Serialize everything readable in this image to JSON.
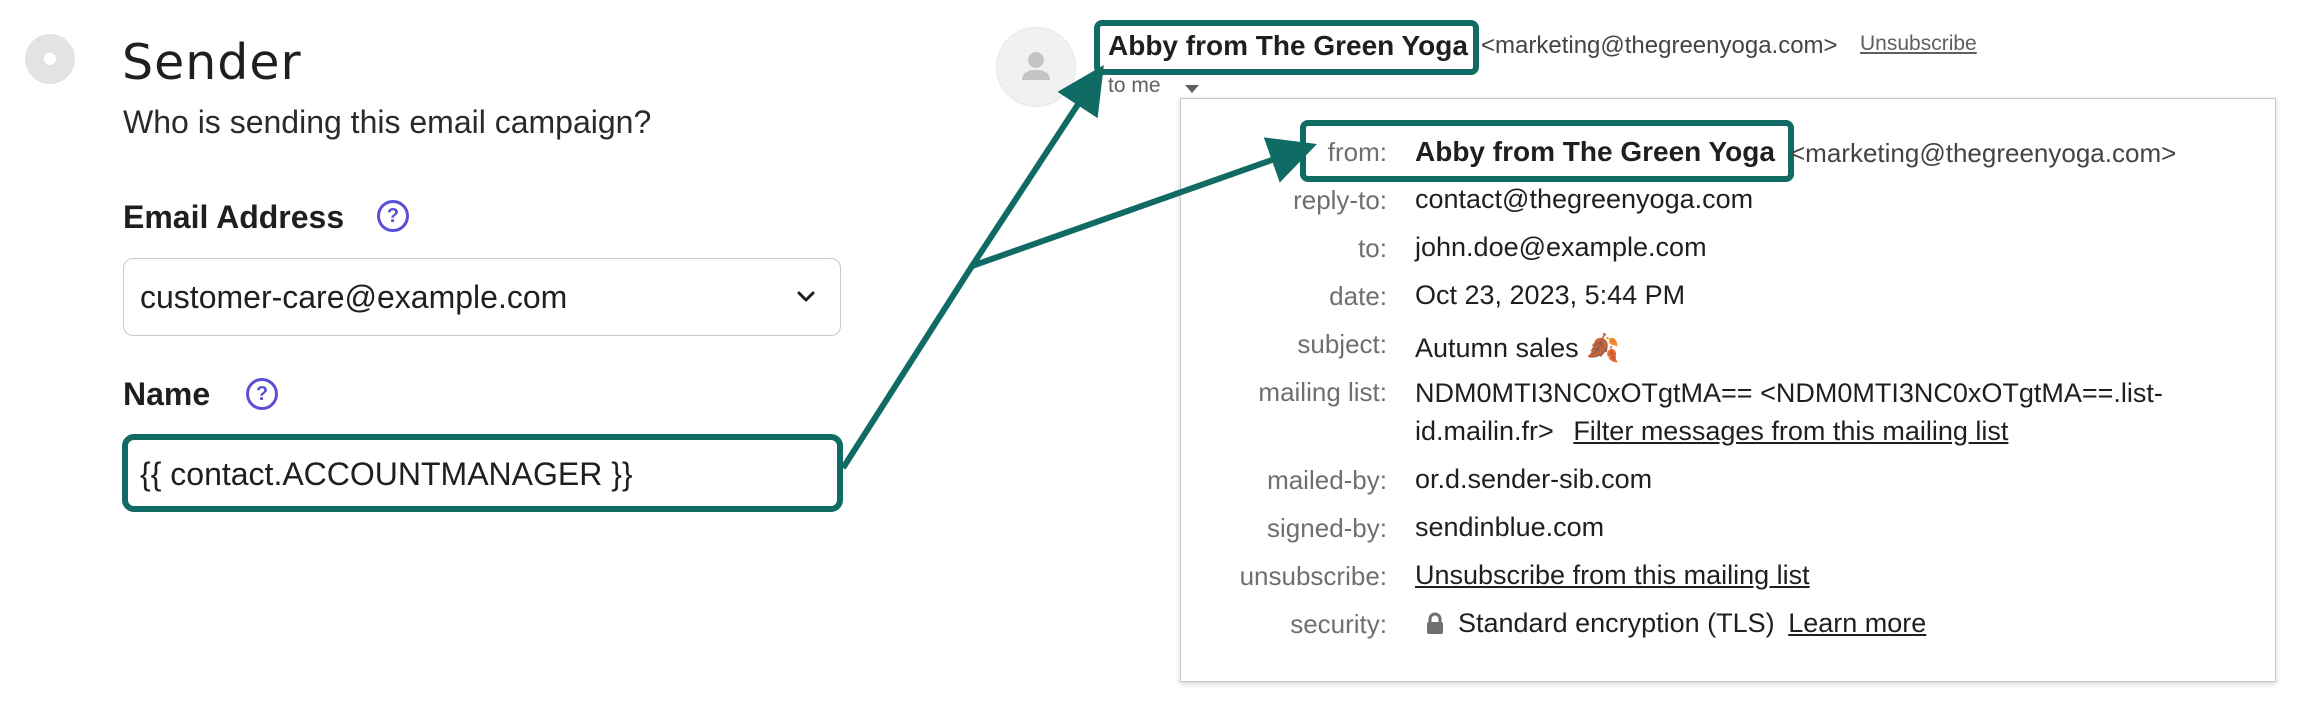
{
  "left_panel": {
    "title": "Sender",
    "subtitle": "Who is sending this email campaign?",
    "email_label": "Email Address",
    "email_value": "customer-care@example.com",
    "name_label": "Name",
    "name_value": "{{ contact.ACCOUNTMANAGER }}",
    "help_glyph": "?"
  },
  "email_header": {
    "sender_name": "Abby from The Green Yoga",
    "sender_email": "<marketing@thegreenyoga.com>",
    "unsubscribe": "Unsubscribe",
    "to_me": "to me"
  },
  "details": {
    "from_label": "from:",
    "from_name": "Abby from The Green Yoga",
    "from_email": "<marketing@thegreenyoga.com>",
    "replyto_label": "reply-to:",
    "replyto_value": "contact@thegreenyoga.com",
    "to_label": "to:",
    "to_value": "john.doe@example.com",
    "date_label": "date:",
    "date_value": "Oct 23, 2023, 5:44 PM",
    "subject_label": "subject:",
    "subject_value": "Autumn sales",
    "subject_emoji": "🍂",
    "mailinglist_label": "mailing list:",
    "mailinglist_line1": "NDM0MTI3NC0xOTgtMA== <NDM0MTI3NC0xOTgtMA==.list-",
    "mailinglist_line2": "id.mailin.fr>",
    "mailinglist_filter": "Filter messages from this mailing list",
    "mailedby_label": "mailed-by:",
    "mailedby_value": "or.d.sender-sib.com",
    "signedby_label": "signed-by:",
    "signedby_value": "sendinblue.com",
    "unsubscribe_label": "unsubscribe:",
    "unsubscribe_value": "Unsubscribe from this mailing list",
    "security_label": "security:",
    "security_value": "Standard encryption (TLS)",
    "security_link": "Learn more"
  },
  "colors": {
    "highlight": "#0f6b64",
    "help_icon": "#5b4fd6"
  },
  "icons": [
    "chevron-down-icon",
    "help-icon",
    "avatar-person-icon",
    "caret-down-icon",
    "lock-icon",
    "leaf-emoji"
  ]
}
